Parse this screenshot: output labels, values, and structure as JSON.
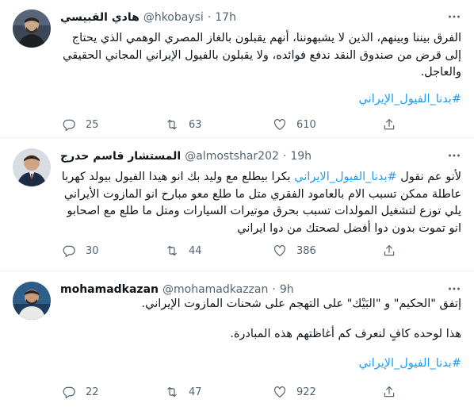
{
  "tweets": [
    {
      "name": "هادي القبيسي",
      "handle": "@hkobaysi",
      "dot": "·",
      "time": "17h",
      "text_lines": [
        "الفرق بيننا وبينهم، الذين لا يشبهوننا، أنهم يقبلون بالغاز المصري الوهمي الذي يحتاج إلى قرض من صندوق النقد ندفع فوائده، ولا يقبلون بالفيول الإيراني المجاني الحقيقي والعاجل."
      ],
      "hashtag": "#بدنا_الفيول_الإيراني",
      "replies": "25",
      "retweets": "63",
      "likes": "610"
    },
    {
      "name": "المستشار قاسم حدرج",
      "handle": "@almostshar202",
      "dot": "·",
      "time": "19h",
      "text_before": "لأنو عم نقول ",
      "inline_tag": "#بدنا_الفيول_الايراني",
      "text_after": " بكرا بيطلع مع وليد بك انو هيدا الفيول بيولد كهربا عاطلة ممكن تسبب الام بالعامود الفقري متل ما طلع معو مبارح انو المازوت الأيراني يلي توزع لتشغيل المولدات تسبب بحرق موتيرات السيارات ومتل ما طلع مع اصحابو انو تموت بدون دوا أفضل لصحتك من دوا ايراني",
      "replies": "30",
      "retweets": "44",
      "likes": "386"
    },
    {
      "name": "mohamadkazan",
      "handle": "@mohamadkazzan",
      "dot": "·",
      "time": "9h",
      "line1": "إتفق \"الحكيم\" و \"البَيْك\" على التهجم على شحنات المازوت الإيراني.",
      "line2": "هذا لوحده كافٍ لنعرف كم أغاظتهم هذه المبادرة.",
      "hashtag": "#بدنا_الفيول_الإيراني",
      "replies": "22",
      "retweets": "47",
      "likes": "922"
    }
  ],
  "icons": {
    "reply": "reply-icon",
    "retweet": "retweet-icon",
    "like": "heart-icon",
    "share": "share-icon",
    "more": "more-icon"
  },
  "colors": {
    "link": "#1d9bf0",
    "secondary": "#536471",
    "divider": "#eff3f4"
  }
}
